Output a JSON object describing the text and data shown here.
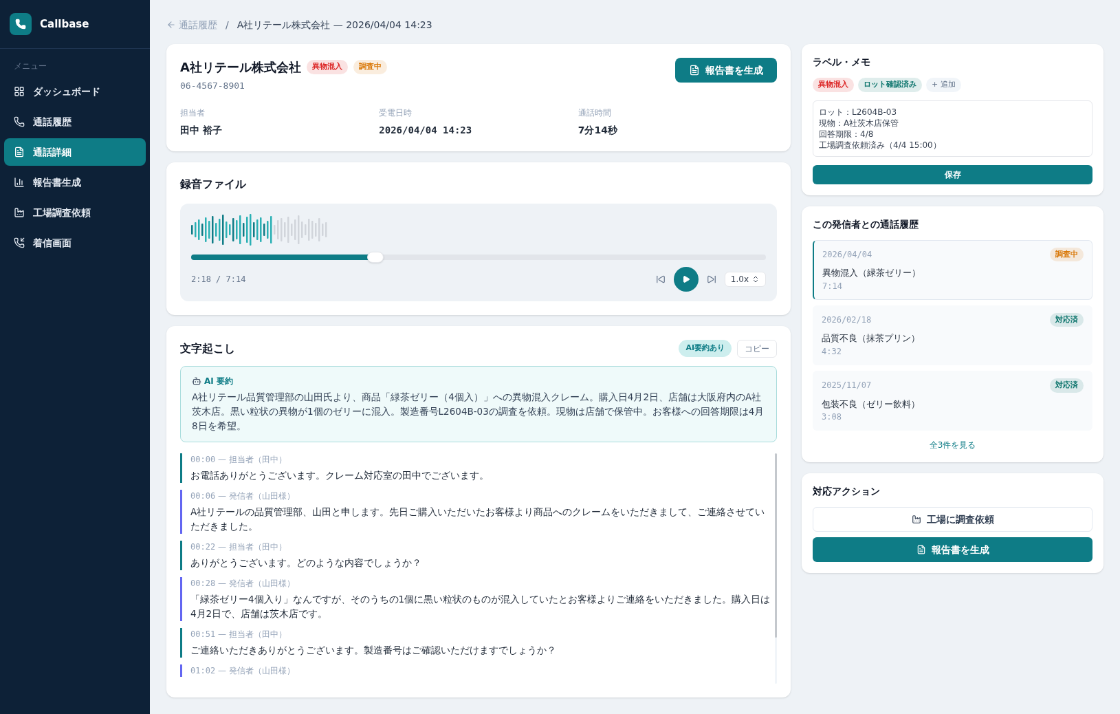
{
  "app": {
    "name": "Callbase"
  },
  "sidebar": {
    "section": "メニュー",
    "items": [
      {
        "label": "ダッシュボード",
        "kind": "grid",
        "selected": false
      },
      {
        "label": "通話履歴",
        "kind": "phone",
        "selected": false
      },
      {
        "label": "通話詳細",
        "kind": "file",
        "selected": true
      },
      {
        "label": "報告書生成",
        "kind": "report",
        "selected": false
      },
      {
        "label": "工場調査依頼",
        "kind": "factory",
        "selected": false
      },
      {
        "label": "着信画面",
        "kind": "incoming",
        "selected": false
      }
    ]
  },
  "breadcrumb": {
    "back": "通話履歴",
    "separator": "/",
    "current": "A社リテール株式会社 — 2026/04/04 14:23"
  },
  "call": {
    "company": "A社リテール株式会社",
    "badges": [
      {
        "label": "異物混入",
        "color": "#dc2626"
      },
      {
        "label": "調査中",
        "color": "#d97706"
      }
    ],
    "phone": "06-4567-8901",
    "action": "報告書を生成",
    "fields": [
      {
        "label": "担当者",
        "value": "田中 裕子",
        "kind": "text"
      },
      {
        "label": "受電日時",
        "value": "2026/04/04 14:23",
        "kind": "mono"
      },
      {
        "label": "通話時間",
        "value": "7分14秒",
        "kind": "text"
      }
    ]
  },
  "recording": {
    "title": "録音ファイル",
    "level": 0.32,
    "time": "2:18 / 7:14",
    "speed": "1.0x"
  },
  "transcript": {
    "title": "文字起こし",
    "ai_badge": "AI要約あり",
    "copy": "コピー",
    "summary_title": "AI 要約",
    "summary": "A社リテール品質管理部の山田氏より、商品「緑茶ゼリー（4個入）」への異物混入クレーム。購入日4月2日、店舗は大阪府内のA社茨木店。黒い粒状の異物が1個のゼリーに混入。製造番号L2604B-03の調査を依頼。現物は店舗で保管中。お客様への回答期限は4月8日を希望。",
    "entries": [
      {
        "kind": "agent",
        "time": "00:00",
        "dash": "—",
        "speaker": "担当者（田中）",
        "text": "お電話ありがとうございます。クレーム対応室の田中でございます。"
      },
      {
        "kind": "caller",
        "time": "00:06",
        "dash": "—",
        "speaker": "発信者（山田様）",
        "text": "A社リテールの品質管理部、山田と申します。先日ご購入いただいたお客様より商品へのクレームをいただきまして、ご連絡させていただきました。"
      },
      {
        "kind": "agent",
        "time": "00:22",
        "dash": "—",
        "speaker": "担当者（田中）",
        "text": "ありがとうございます。どのような内容でしょうか？"
      },
      {
        "kind": "caller",
        "time": "00:28",
        "dash": "—",
        "speaker": "発信者（山田様）",
        "text": "「緑茶ゼリー4個入り」なんですが、そのうちの1個に黒い粒状のものが混入していたとお客様よりご連絡をいただきました。購入日は4月2日で、店舗は茨木店です。"
      },
      {
        "kind": "agent",
        "time": "00:51",
        "dash": "—",
        "speaker": "担当者（田中）",
        "text": "ご連絡いただきありがとうございます。製造番号はご確認いただけますでしょうか？"
      },
      {
        "kind": "caller",
        "time": "01:02",
        "dash": "—",
        "speaker": "発信者（山田様）"
      }
    ]
  },
  "labels": {
    "title": "ラベル・メモ",
    "tags": [
      {
        "label": "異物混入",
        "color": "#dc2626"
      },
      {
        "label": "ロット確認済み",
        "color": "#0f766e"
      }
    ],
    "add": "+ 追加",
    "memo": [
      "ロット：L2604B-03",
      "現物：A社茨木店保管",
      "回答期限：4/8",
      "工場調査依頼済み（4/4 15:00）"
    ],
    "save": "保存"
  },
  "history": {
    "title": "この発信者との通話履歴",
    "items": [
      {
        "date": "2026/04/04",
        "status": "調査中",
        "color": "#d97706",
        "title": "異物混入（緑茶ゼリー）",
        "duration": "7:14",
        "selected": true
      },
      {
        "date": "2026/02/18",
        "status": "対応済",
        "color": "#0f766e",
        "title": "品質不良（抹茶プリン）",
        "duration": "4:32",
        "selected": false
      },
      {
        "date": "2025/11/07",
        "status": "対応済",
        "color": "#0f766e",
        "title": "包装不良（ゼリー飲料）",
        "duration": "3:08",
        "selected": false
      }
    ],
    "more": "全3件を見る"
  },
  "actions": {
    "title": "対応アクション",
    "buttons": [
      {
        "kind": "secondary",
        "label": "工場に調査依頼"
      },
      {
        "kind": "primary",
        "label": "報告書を生成"
      }
    ]
  }
}
